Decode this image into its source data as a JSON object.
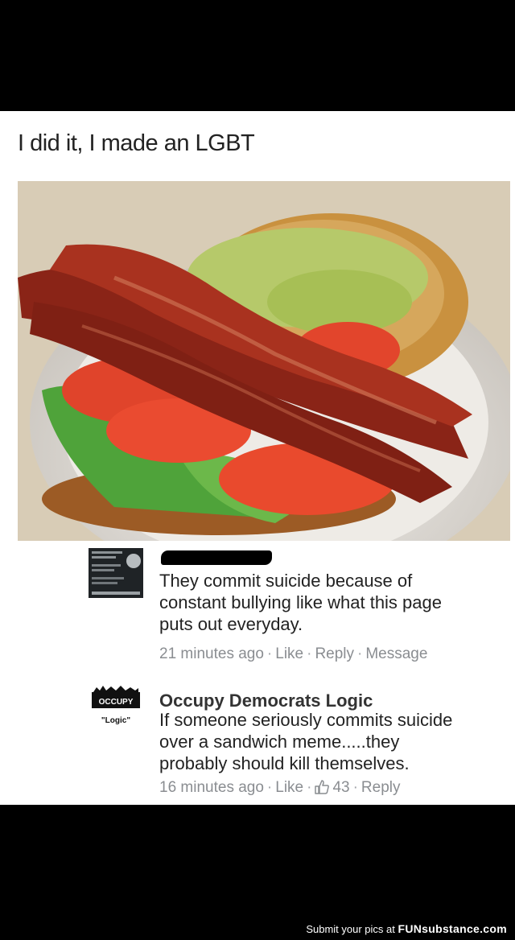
{
  "post": {
    "caption": "I did it, I made an LGBT"
  },
  "comments": [
    {
      "text": "They commit suicide because of\nconstant bullying like what this page\nputs out everyday.",
      "time": "21 minutes ago",
      "like": "Like",
      "reply": "Reply",
      "message": "Message"
    },
    {
      "author": "Occupy Democrats Logic",
      "text": "If someone seriously commits suicide\nover a sandwich meme.....they\nprobably should kill themselves.",
      "time": "16 minutes ago",
      "like": "Like",
      "reactions": "43",
      "reply": "Reply",
      "avatar_text": "\"Logic\"",
      "avatar_logo": "OCCUPY"
    }
  ],
  "footer": {
    "text": "Submit your pics at",
    "brand": "FUNsubstance.com"
  },
  "colors": {
    "background": "#000000",
    "meta_text": "#8a8d91"
  }
}
